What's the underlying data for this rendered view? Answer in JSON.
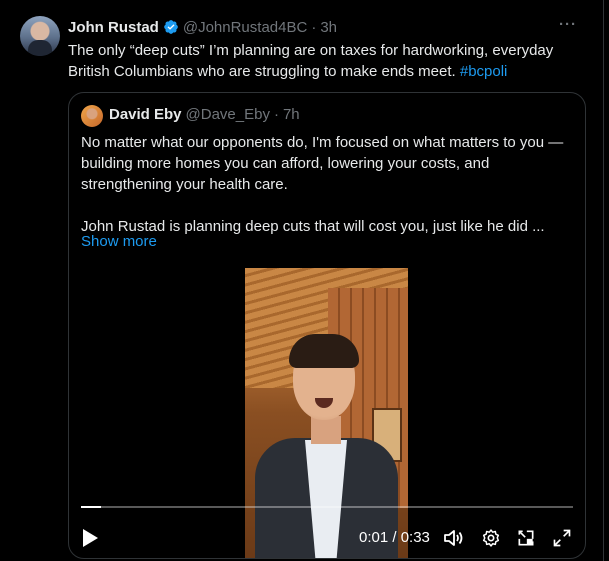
{
  "tweet": {
    "author_name": "John Rustad",
    "handle": "@JohnRustad4BC",
    "separator": "·",
    "time": "3h",
    "more": "···",
    "text": "The only “deep cuts” I’m planning are on taxes for hardworking, everyday British Columbians who are struggling to make ends meet.",
    "hashtag": "#bcpoli"
  },
  "quote": {
    "author_name": "David Eby",
    "handle": "@Dave_Eby",
    "separator": "·",
    "time": "7h",
    "paragraph_1": "No matter what our opponents do, I'm focused on what matters to you —building more homes you can afford, lowering your costs, and strengthening your health care.",
    "paragraph_2": "John Rustad is planning deep cuts that will cost you, just like he did ...",
    "show_more": "Show more"
  },
  "video": {
    "time_display": "0:01 / 0:33",
    "progress_fraction": 0.04
  },
  "colors": {
    "accent": "#1d9bf0",
    "text": "#e7e9ea",
    "muted": "#71767b",
    "background": "#000000"
  },
  "icons": [
    "verified-badge-icon",
    "more-icon",
    "play-icon",
    "volume-icon",
    "settings-icon",
    "picture-in-picture-icon",
    "fullscreen-icon"
  ]
}
